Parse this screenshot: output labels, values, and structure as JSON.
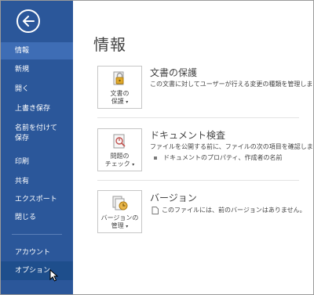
{
  "sidebar": {
    "back_label": "",
    "items": [
      {
        "label": "情報"
      },
      {
        "label": "新規"
      },
      {
        "label": "開く"
      },
      {
        "label": "上書き保存"
      },
      {
        "label": "名前を付けて"
      },
      {
        "label": "保存"
      },
      {
        "label": "印刷"
      },
      {
        "label": "共有"
      },
      {
        "label": "エクスポート"
      },
      {
        "label": "閉じる"
      },
      {
        "label": "アカウント"
      },
      {
        "label": "オプション"
      }
    ]
  },
  "main": {
    "title": "情報",
    "sections": [
      {
        "button_line1": "文書の",
        "button_line2": "保護",
        "button_caret": "▾",
        "title": "文書の保護",
        "description": "この文書に対してユーザーが行える変更の種類を管理します。",
        "icon": "lock-key-icon"
      },
      {
        "button_line1": "問題の",
        "button_line2": "チェック",
        "button_caret": "▾",
        "title": "ドキュメント検査",
        "description": "ファイルを公開する前に、ファイルの次の項目を確認します。",
        "bullet": "ドキュメントのプロパティ、作成者の名前",
        "icon": "inspect-document-icon"
      },
      {
        "button_line1": "バージョンの",
        "button_line2": "管理",
        "button_caret": "▾",
        "title": "バージョン",
        "bullet": "このファイルには、前のバージョンはありません。",
        "icon": "versions-icon"
      }
    ]
  },
  "colors": {
    "sidebar_bg": "#2b579a",
    "sidebar_selected": "#3e6db5",
    "sidebar_hover": "#1e4e8c"
  }
}
